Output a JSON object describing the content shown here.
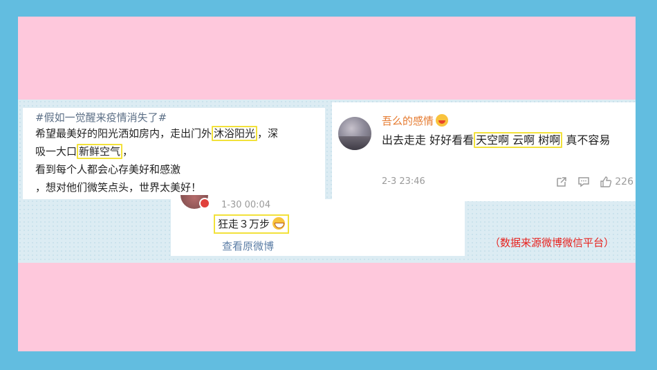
{
  "left_post": {
    "hashtag": "#假如一觉醒来疫情消失了#",
    "line1_pre": "希望最美好的阳光洒如房内，走出门外",
    "line1_hl": "沐浴阳光",
    "line1_post": "，深",
    "line2_pre": "吸一大口",
    "line2_hl": "新鲜空气",
    "line2_post": "，",
    "line3": "看到每个人都会心存美好和感激",
    "line4": "，想对他们微笑点头，世界太美好！"
  },
  "right_post": {
    "user_name": "吾么的感情",
    "text_pre": "出去走走 好好看看",
    "text_hl": "天空啊 云啊 树啊",
    "text_post": "真不容易",
    "date": "2-3 23:46",
    "like_count": "226",
    "icons": [
      "share-icon",
      "comment-icon",
      "like-icon"
    ]
  },
  "bottom_post": {
    "date": "1-30 00:04",
    "comment": "狂走３万步",
    "view_original": "查看原微博"
  },
  "source_note": "（数据来源微博微信平台）",
  "colors": {
    "outer": "#62bde0",
    "band": "#fec8dc",
    "highlight": "#f2e13a",
    "username": "#e57a2f",
    "source_note": "#e8231f",
    "link": "#5c7ea6"
  }
}
